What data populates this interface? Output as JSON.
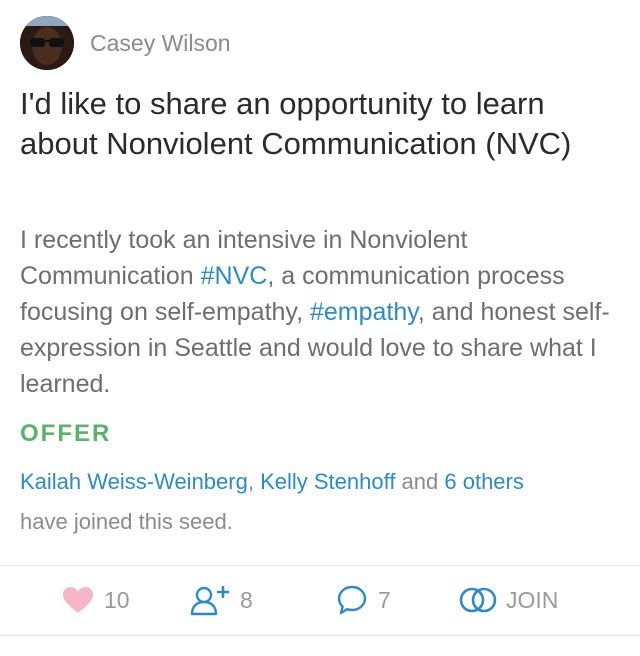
{
  "post": {
    "author": "Casey Wilson",
    "title": "I'd like to share an opportunity to learn about Nonviolent Communication (NVC)",
    "body": {
      "part1": "I recently took an intensive in Nonviolent Communication ",
      "tag1": "#NVC",
      "part2": ", a communication process focusing on self-empathy, ",
      "tag2": "#empathy",
      "part3": ", and honest self-expression in Seattle and would love to share what I learned."
    },
    "type_label": "OFFER",
    "joined": {
      "member1": "Kailah Weiss-Weinberg",
      "separator": ", ",
      "member2": "Kelly Stenhoff",
      "and_text": " and ",
      "others": "6 others",
      "suffix": "have joined this seed."
    }
  },
  "actions": {
    "likes": "10",
    "members": "8",
    "comments": "7",
    "join_label": "JOIN"
  },
  "colors": {
    "link": "#2e8ac7",
    "offer": "#5bb36a",
    "heart": "#f7b6c7",
    "muted": "#8b8b8b"
  }
}
